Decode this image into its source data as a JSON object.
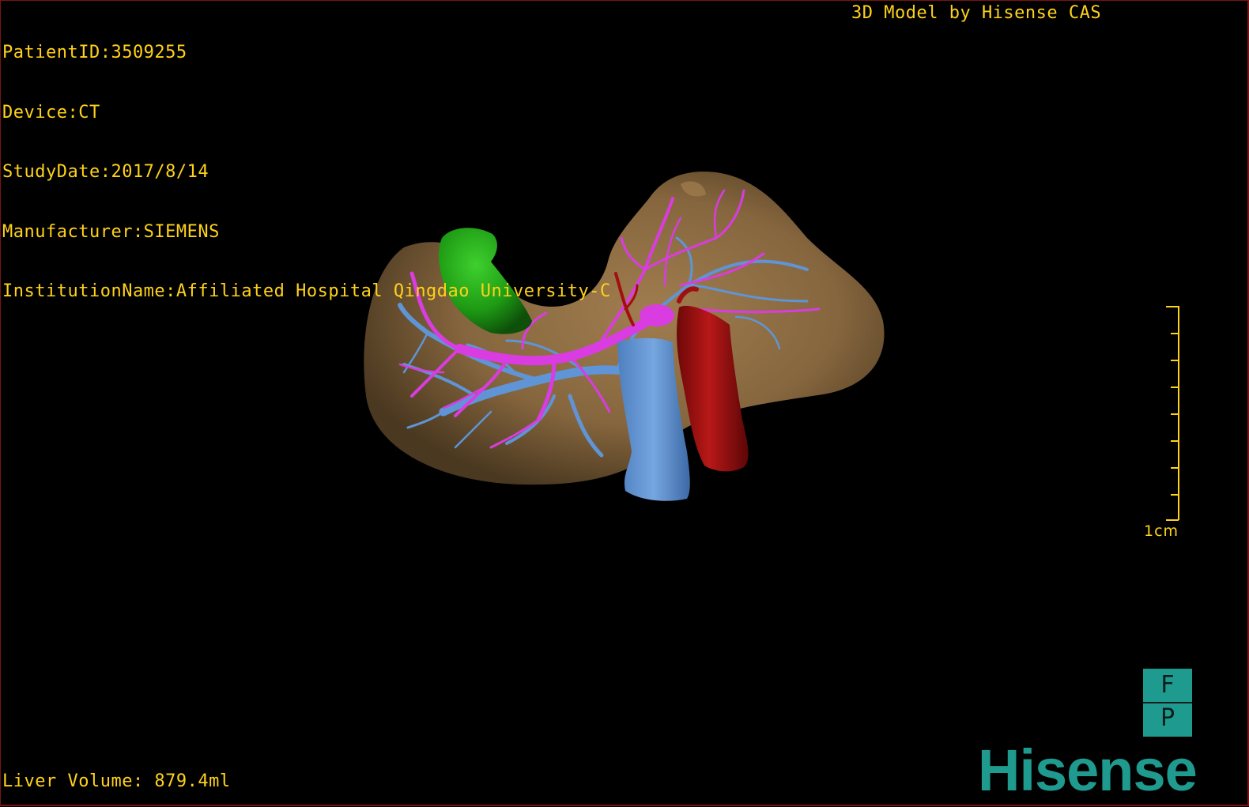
{
  "patient_info": {
    "patient_id": "PatientID:3509255",
    "device": "Device:CT",
    "study_date": "StudyDate:2017/8/14",
    "manufacturer": "Manufacturer:SIEMENS",
    "institution": "InstitutionName:Affiliated Hospital Qingdao University-C"
  },
  "title": "3D Model by Hisense CAS",
  "liver_volume": "Liver Volume: 879.4ml",
  "scale": {
    "label": "1cm",
    "ticks": 9
  },
  "orientation_marker": {
    "top": "F",
    "bottom": "P"
  },
  "brand": "Hisense",
  "colors": {
    "overlay_text": "#ffd21a",
    "liver": "#8b6a40",
    "portal_vein": "#d93ce0",
    "hepatic_vein": "#5f95d6",
    "artery_aorta": "#9e0f0f",
    "gallbladder": "#1e9b14",
    "brand": "#1f9a8f"
  }
}
